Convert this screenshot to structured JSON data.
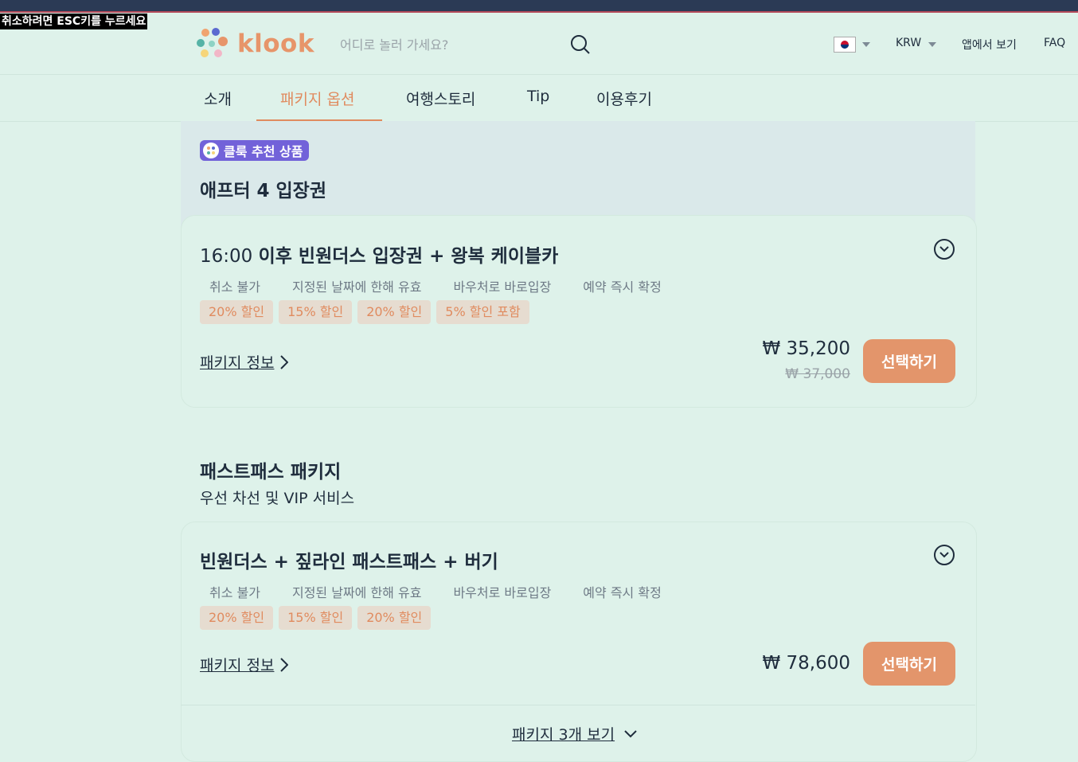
{
  "overlay": {
    "esc_hint": "취소하려면 ESC키를 누르세요"
  },
  "header": {
    "logo": "klook",
    "search_placeholder": "어디로 놀러 가세요?",
    "currency": "KRW",
    "app_link": "앱에서 보기",
    "faq": "FAQ"
  },
  "tabs": [
    {
      "label": "소개"
    },
    {
      "label": "패키지 옵션",
      "active": true
    },
    {
      "label": "여행스토리"
    },
    {
      "label": "Tip"
    },
    {
      "label": "이용후기"
    }
  ],
  "recommended": {
    "badge": "클룩 추천 상품",
    "title": "애프터 4 입장권",
    "package": {
      "time": "16:00",
      "title": "이후 빈원더스 입장권 + 왕복 케이블카",
      "tags": [
        "취소 불가",
        "지정된 날짜에 한해 유효",
        "바우처로 바로입장",
        "예약 즉시 확정"
      ],
      "discounts": [
        "20% 할인",
        "15% 할인",
        "20% 할인",
        "5% 할인 포함"
      ],
      "info_link": "패키지 정보",
      "price": "₩ 35,200",
      "old_price": "₩ 37,000",
      "select_label": "선택하기"
    }
  },
  "fastpass": {
    "title": "패스트패스 패키지",
    "subtitle": "우선 차선 및 VIP 서비스",
    "package": {
      "title": "빈원더스 + 짚라인 패스트패스 + 버기",
      "tags": [
        "취소 불가",
        "지정된 날짜에 한해 유효",
        "바우처로 바로입장",
        "예약 즉시 확정"
      ],
      "discounts": [
        "20% 할인",
        "15% 할인",
        "20% 할인"
      ],
      "info_link": "패키지 정보",
      "price": "₩ 78,600",
      "select_label": "선택하기"
    },
    "more_link": "패키지 3개 보기"
  },
  "colors": {
    "accent": "#e3956b",
    "badge": "#7262d9",
    "background": "#def2ea"
  }
}
